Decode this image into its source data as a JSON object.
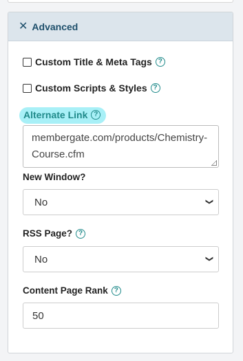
{
  "panel": {
    "title": "Advanced",
    "close_icon": "close-icon"
  },
  "fields": {
    "custom_title_meta": {
      "label": "Custom Title & Meta Tags",
      "checked": false
    },
    "custom_scripts_styles": {
      "label": "Custom Scripts & Styles",
      "checked": false
    },
    "alternate_link": {
      "label": "Alternate Link",
      "value": "membergate.com/products/Chemistry-Course.cfm",
      "highlight_color": "#a8f0f7"
    },
    "new_window": {
      "label": "New Window?",
      "value": "No"
    },
    "rss_page": {
      "label": "RSS Page?",
      "value": "No"
    },
    "content_page_rank": {
      "label": "Content Page Rank",
      "value": "50"
    }
  },
  "colors": {
    "header_bg": "#dce5ec",
    "header_text": "#1e4f6b",
    "help_icon": "#1f8a8a"
  }
}
